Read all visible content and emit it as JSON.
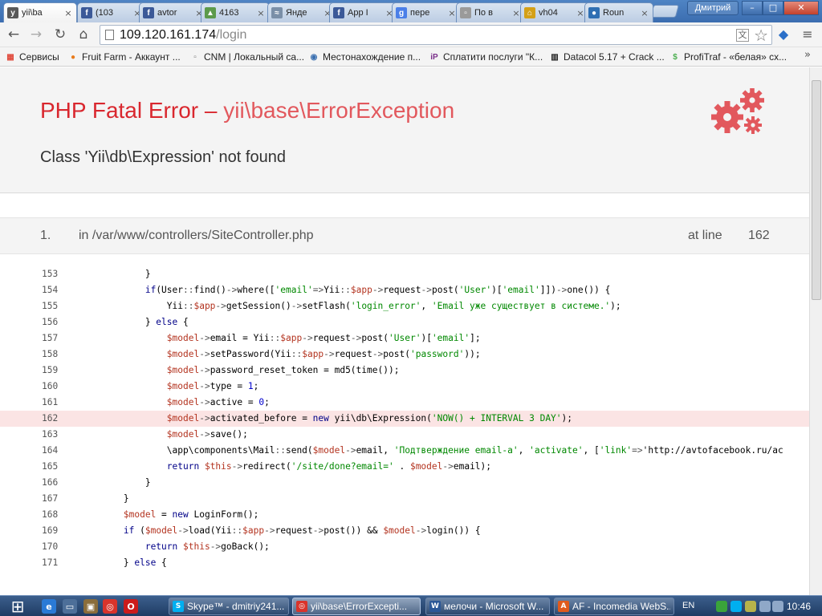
{
  "browser": {
    "tabs": [
      {
        "title": "yii\\ba",
        "icon": "yii-icon",
        "color": "#5a5a5a",
        "glyph": "y",
        "active": true
      },
      {
        "title": "(103",
        "icon": "facebook-icon",
        "color": "#3b5998",
        "glyph": "f",
        "active": false
      },
      {
        "title": "avtor",
        "icon": "facebook-icon",
        "color": "#3b5998",
        "glyph": "f",
        "active": false
      },
      {
        "title": "4163",
        "icon": "image-icon",
        "color": "#5c9a4b",
        "glyph": "▲",
        "active": false
      },
      {
        "title": "Янде",
        "icon": "page-icon",
        "color": "#7a8fa8",
        "glyph": "≈",
        "active": false
      },
      {
        "title": "App I",
        "icon": "facebook-icon",
        "color": "#3b5998",
        "glyph": "f",
        "active": false
      },
      {
        "title": "пере",
        "icon": "google-icon",
        "color": "#4a7fe8",
        "glyph": "g",
        "active": false
      },
      {
        "title": "По в",
        "icon": "document-icon",
        "color": "#9a9a9a",
        "glyph": "▫",
        "active": false
      },
      {
        "title": "vh04",
        "icon": "house-icon",
        "color": "#d4a017",
        "glyph": "⌂",
        "active": false
      },
      {
        "title": "Roun",
        "icon": "roundcube-icon",
        "color": "#2f6fb3",
        "glyph": "●",
        "active": false
      }
    ],
    "user_name": "Дмитрий",
    "window_controls": {
      "minimize": "–",
      "maximize": "□",
      "close": "✕"
    },
    "url_host": "109.120.161.174",
    "url_path": "/login",
    "bookmarks": [
      {
        "label": "Сервисы",
        "icon": "apps-icon",
        "color": "#e04a3c",
        "glyph": "▦"
      },
      {
        "label": "Fruit Farm - Аккаунт ...",
        "icon": "fruit-icon",
        "color": "#e87b1c",
        "glyph": "●"
      },
      {
        "label": "CNM | Локальный са...",
        "icon": "document-icon",
        "color": "#777777",
        "glyph": "▫"
      },
      {
        "label": "Местонахождение п...",
        "icon": "location-icon",
        "color": "#3a6fb0",
        "glyph": "◉"
      },
      {
        "label": "Сплатити послуги \"К...",
        "icon": "ip-icon",
        "color": "#7a2f8a",
        "glyph": "iP"
      },
      {
        "label": "Datacol 5.17 + Crack ...",
        "icon": "datacol-icon",
        "color": "#222222",
        "glyph": "▥"
      },
      {
        "label": "ProfiTraf - «белая» сх...",
        "icon": "profitraf-icon",
        "color": "#4caf50",
        "glyph": "$"
      }
    ]
  },
  "error": {
    "title": "PHP Fatal Error",
    "separator": "–",
    "exception": "yii\\base\\ErrorException",
    "message": "Class 'Yii\\db\\Expression' not found",
    "icon": "gears-icon",
    "call_index": "1.",
    "call_file": "in /var/www/controllers/SiteController.php",
    "call_at": "at line",
    "call_line": "162",
    "highlight_line": 162,
    "code": [
      {
        "n": "153",
        "t": "            }"
      },
      {
        "n": "154",
        "t": "            if(User::find()->where(['email'=>Yii::$app->request->post('User')['email']])->one()) {"
      },
      {
        "n": "155",
        "t": "                Yii::$app->getSession()->setFlash('login_error', 'Email уже существует в системе.');"
      },
      {
        "n": "156",
        "t": "            } else {"
      },
      {
        "n": "157",
        "t": "                $model->email = Yii::$app->request->post('User')['email'];"
      },
      {
        "n": "158",
        "t": "                $model->setPassword(Yii::$app->request->post('password'));"
      },
      {
        "n": "159",
        "t": "                $model->password_reset_token = md5(time());"
      },
      {
        "n": "160",
        "t": "                $model->type = 1;"
      },
      {
        "n": "161",
        "t": "                $model->active = 0;"
      },
      {
        "n": "162",
        "t": "                $model->activated_before = new yii\\db\\Expression('NOW() + INTERVAL 3 DAY');"
      },
      {
        "n": "163",
        "t": "                $model->save();"
      },
      {
        "n": "164",
        "t": "                \\app\\components\\Mail::send($model->email, 'Подтверждение email-а', 'activate', ['link'=>'http://avtofacebook.ru/ac"
      },
      {
        "n": "165",
        "t": "                return $this->redirect('/site/done?email=' . $model->email);"
      },
      {
        "n": "166",
        "t": "            }"
      },
      {
        "n": "167",
        "t": "        }"
      },
      {
        "n": "168",
        "t": "        $model = new LoginForm();"
      },
      {
        "n": "169",
        "t": "        if ($model->load(Yii::$app->request->post()) && $model->login()) {"
      },
      {
        "n": "170",
        "t": "            return $this->goBack();"
      },
      {
        "n": "171",
        "t": "        } else {"
      }
    ]
  },
  "taskbar": {
    "start_icon": "windows-start-icon",
    "quicklaunch": [
      {
        "icon": "ie-icon",
        "color": "#2a7ad6",
        "glyph": "e"
      },
      {
        "icon": "desktop-icon",
        "color": "#4d6f99",
        "glyph": "▭"
      },
      {
        "icon": "box-icon",
        "color": "#8a6d3b",
        "glyph": "▣"
      },
      {
        "icon": "chrome-icon",
        "color": "#d9342b",
        "glyph": "◎"
      },
      {
        "icon": "opera-icon",
        "color": "#cc1b1b",
        "glyph": "O"
      }
    ],
    "tasks": [
      {
        "label": "Skype™ - dmitriy241...",
        "icon": "skype-icon",
        "color": "#00aff0",
        "glyph": "S",
        "active": false
      },
      {
        "label": "yii\\base\\ErrorExcepti...",
        "icon": "chrome-icon",
        "color": "#d9342b",
        "glyph": "◎",
        "active": true
      },
      {
        "label": "мелочи - Microsoft W...",
        "icon": "word-icon",
        "color": "#2b5797",
        "glyph": "W",
        "active": false
      },
      {
        "label": "AF - Incomedia WebS...",
        "icon": "website-icon",
        "color": "#e05a1c",
        "glyph": "A",
        "active": false
      }
    ],
    "language": "EN",
    "tray": [
      {
        "icon": "security-icon",
        "color": "#3aa43a"
      },
      {
        "icon": "skype-tray-icon",
        "color": "#00aff0"
      },
      {
        "icon": "notes-icon",
        "color": "#b7b34a"
      },
      {
        "icon": "network-icon",
        "color": "#8fa8c8"
      },
      {
        "icon": "volume-icon",
        "color": "#8fa8c8"
      }
    ],
    "clock": "10:46"
  }
}
